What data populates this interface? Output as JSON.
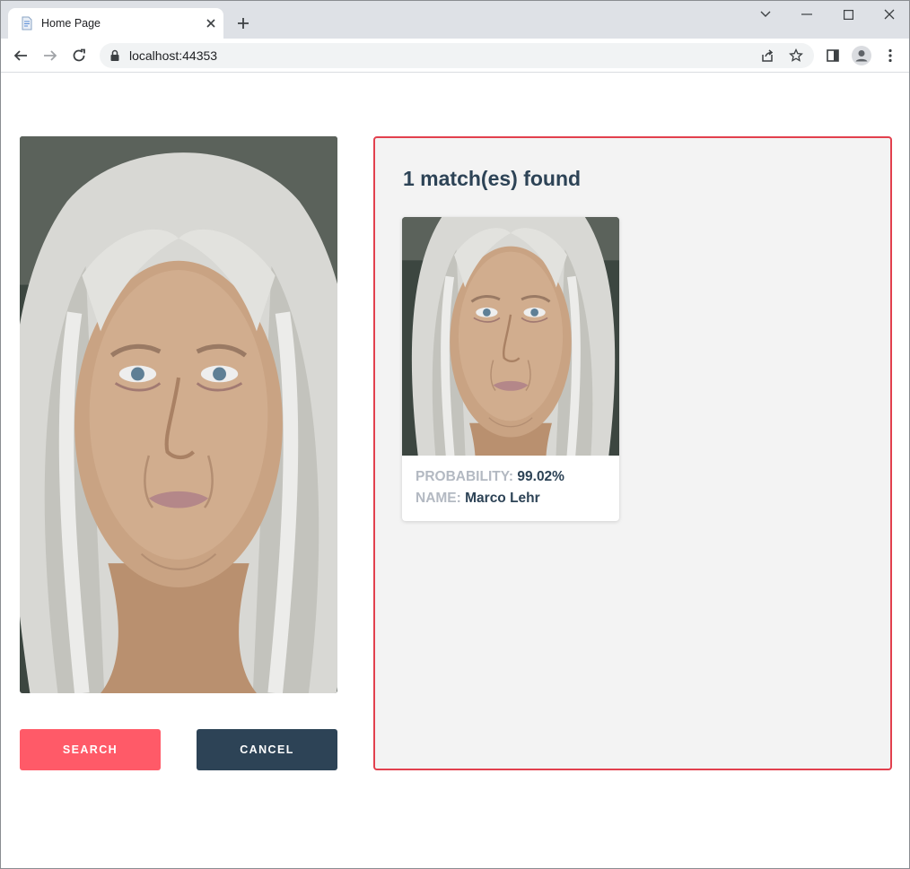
{
  "browser": {
    "tab_title": "Home Page",
    "url": "localhost:44353"
  },
  "left": {
    "search_label": "SEARCH",
    "cancel_label": "CANCEL"
  },
  "results": {
    "title": "1 match(es) found",
    "matches": [
      {
        "probability_label": "PROBABILITY:",
        "probability_value": "99.02%",
        "name_label": "NAME:",
        "name_value": "Marco Lehr"
      }
    ]
  },
  "colors": {
    "accent": "#ff5a68",
    "dark": "#2d4356",
    "border": "#e2404e",
    "panel_bg": "#f3f3f3"
  },
  "icons": [
    "document-icon",
    "close-icon",
    "plus-icon",
    "chevron-down-icon",
    "minimize-icon",
    "maximize-icon",
    "back-arrow-icon",
    "forward-arrow-icon",
    "reload-icon",
    "lock-icon",
    "share-icon",
    "star-icon",
    "side-panel-icon",
    "profile-icon",
    "more-vert-icon"
  ]
}
